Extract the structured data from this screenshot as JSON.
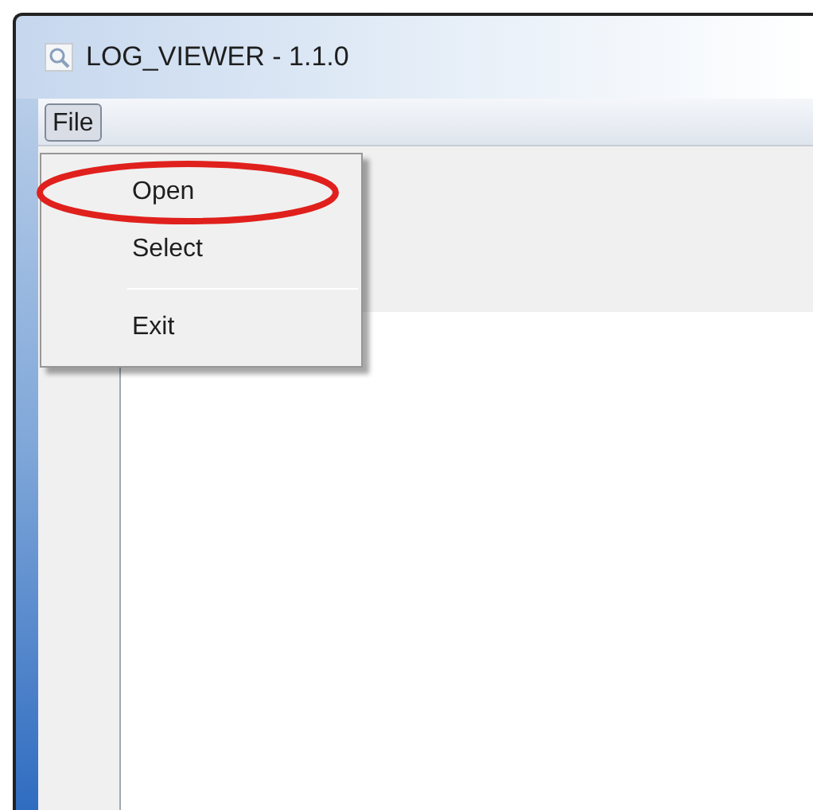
{
  "window": {
    "title": "LOG_VIEWER - 1.1.0"
  },
  "menu_bar": [
    {
      "label": "File",
      "selected": true
    }
  ],
  "file_menu": {
    "items": [
      {
        "kind": "item",
        "label": "Open",
        "circled": true
      },
      {
        "kind": "item",
        "label": "Select",
        "circled": false
      },
      {
        "kind": "separator"
      },
      {
        "kind": "item",
        "label": "Exit",
        "circled": false
      }
    ]
  }
}
